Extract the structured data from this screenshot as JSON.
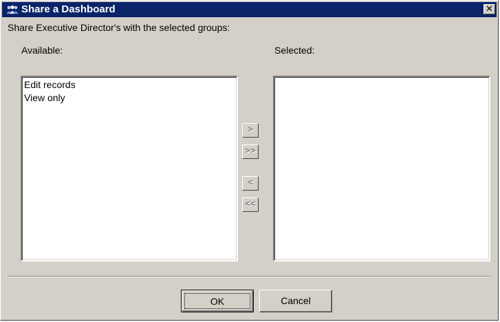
{
  "window": {
    "title": "Share a Dashboard",
    "close_glyph": "✕",
    "icon": "people-group-icon"
  },
  "prompt": "Share Executive Director's with the selected groups:",
  "available": {
    "label": "Available:",
    "items": [
      "Edit records",
      "View only"
    ]
  },
  "selected": {
    "label": "Selected:",
    "items": []
  },
  "move_buttons": {
    "add": ">",
    "add_all": ">>",
    "remove": "<",
    "remove_all": "<<"
  },
  "footer": {
    "ok": "OK",
    "cancel": "Cancel"
  },
  "colors": {
    "titlebar": "#0a246a",
    "face": "#d4d0c8"
  }
}
